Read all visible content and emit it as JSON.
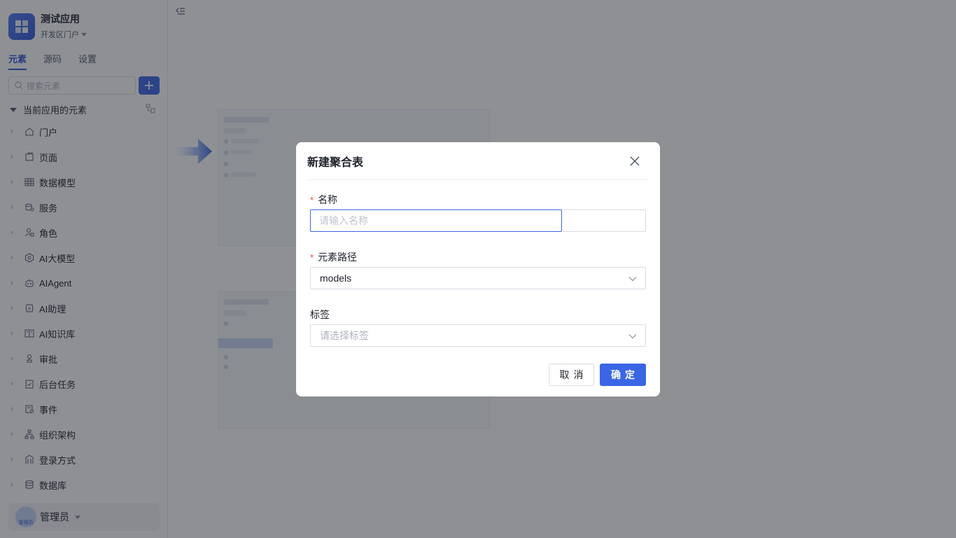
{
  "app": {
    "title": "测试应用",
    "portal": "开发区门户"
  },
  "tabs": [
    {
      "label": "元素",
      "active": true
    },
    {
      "label": "源码",
      "active": false
    },
    {
      "label": "设置",
      "active": false
    }
  ],
  "search": {
    "placeholder": "搜索元素"
  },
  "section": {
    "title": "当前应用的元素"
  },
  "tree": [
    {
      "label": "门户",
      "icon": "home-icon"
    },
    {
      "label": "页面",
      "icon": "page-icon"
    },
    {
      "label": "数据模型",
      "icon": "table-icon"
    },
    {
      "label": "服务",
      "icon": "database-service-icon"
    },
    {
      "label": "角色",
      "icon": "role-icon"
    },
    {
      "label": "AI大模型",
      "icon": "ai-model-icon"
    },
    {
      "label": "AIAgent",
      "icon": "robot-icon"
    },
    {
      "label": "AI助理",
      "icon": "ai-assistant-icon"
    },
    {
      "label": "AI知识库",
      "icon": "book-icon"
    },
    {
      "label": "审批",
      "icon": "approval-icon"
    },
    {
      "label": "后台任务",
      "icon": "task-icon"
    },
    {
      "label": "事件",
      "icon": "event-icon"
    },
    {
      "label": "组织架构",
      "icon": "org-icon"
    },
    {
      "label": "登录方式",
      "icon": "login-icon"
    },
    {
      "label": "数据库",
      "icon": "database-icon"
    }
  ],
  "user": {
    "name": "管理员",
    "avatar_text": "管理员"
  },
  "modal": {
    "title": "新建聚合表",
    "name_label": "名称",
    "name_placeholder": "请输入名称",
    "path_label": "元素路径",
    "path_value": "models",
    "tag_label": "标签",
    "tag_placeholder": "请选择标签",
    "cancel_label": "取消",
    "ok_label": "确定"
  },
  "colors": {
    "primary": "#3a66e5",
    "required": "#f53f3f",
    "overlay": "rgba(29,33,41,0.5)"
  }
}
